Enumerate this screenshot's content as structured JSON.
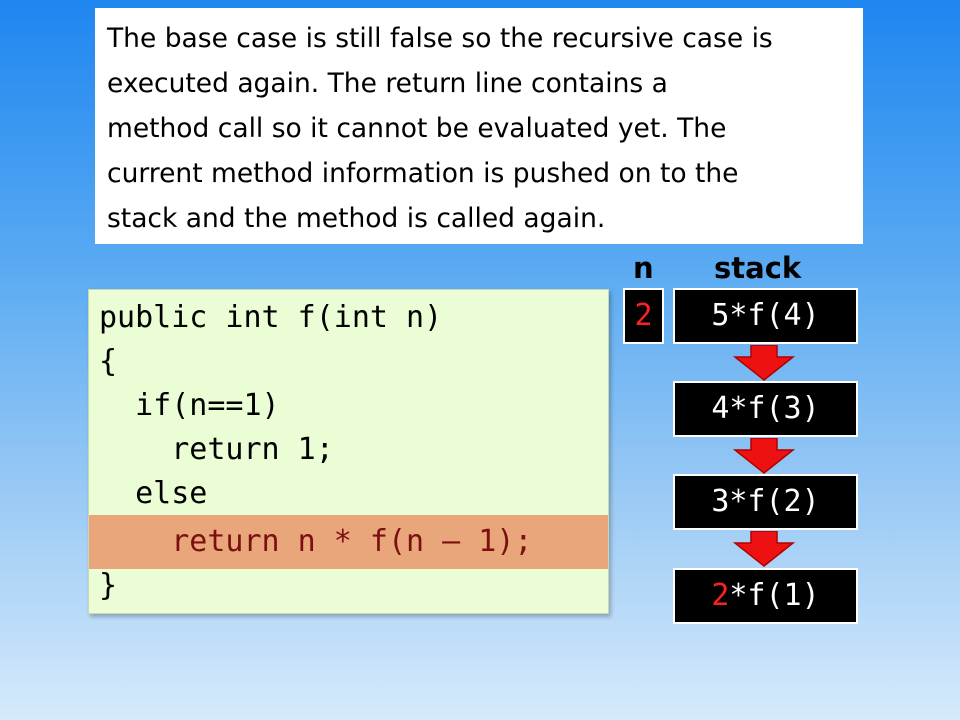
{
  "explanation": "The base case is still false so the recursive case is\nexecuted again. The return line contains a\nmethod call so it cannot be evaluated yet. The\ncurrent method information is pushed on to the\nstack and the method is called again.",
  "code": {
    "lines": [
      "public int f(int n)",
      "{",
      "  if(n==1)",
      "    return 1;",
      "  else",
      "    return n * f(n – 1);",
      "}"
    ],
    "highlighted_line_index": 5
  },
  "headers": {
    "n": "n",
    "stack": "stack"
  },
  "n_value": "2",
  "stack": {
    "frames": [
      {
        "prefix": "5",
        "rest": "*f(4)"
      },
      {
        "prefix": "4",
        "rest": "*f(3)"
      },
      {
        "prefix": "3",
        "rest": "*f(2)"
      },
      {
        "prefix": "2",
        "rest": "*f(1)"
      }
    ],
    "highlighted_prefix_index": 3
  },
  "colors": {
    "highlight_background": "#e8a67a",
    "highlight_text": "#7a1010",
    "n_value": "#ff2020",
    "arrow": "#ee1111"
  }
}
